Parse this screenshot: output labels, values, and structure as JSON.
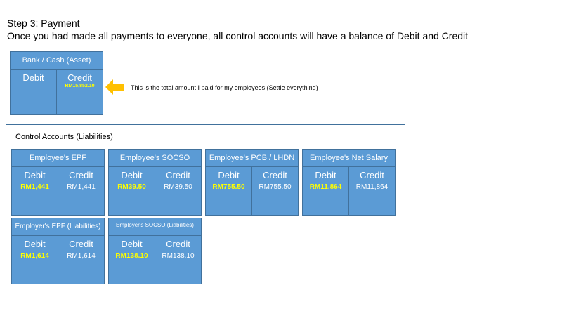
{
  "header": {
    "step": "Step 3: Payment",
    "description": "Once you had made all payments to everyone, all control accounts will have a balance of Debit and Credit"
  },
  "bank_account": {
    "title": "Bank / Cash (Asset)",
    "debit_label": "Debit",
    "credit_label": "Credit",
    "credit_value": "RM15,852.10"
  },
  "note": "This is the total amount I paid for my employees  (Settle everything)",
  "control_group": {
    "title": "Control Accounts (Liabilities)"
  },
  "accounts": {
    "employee_epf": {
      "title": "Employee's EPF",
      "debit_label": "Debit",
      "credit_label": "Credit",
      "debit": "RM1,441",
      "credit": "RM1,441"
    },
    "employee_socso": {
      "title": "Employee's SOCSO",
      "debit_label": "Debit",
      "credit_label": "Credit",
      "debit": "RM39.50",
      "credit": "RM39.50"
    },
    "employee_pcb": {
      "title": "Employee's PCB / LHDN",
      "debit_label": "Debit",
      "credit_label": "Credit",
      "debit": "RM755.50",
      "credit": "RM755.50"
    },
    "employee_net_salary": {
      "title": "Employee's Net Salary",
      "debit_label": "Debit",
      "credit_label": "Credit",
      "debit": "RM11,864",
      "credit": "RM11,864"
    },
    "employer_epf": {
      "title": "Employer's EPF (Liabilities)",
      "debit_label": "Debit",
      "credit_label": "Credit",
      "debit": "RM1,614",
      "credit": "RM1,614"
    },
    "employer_socso": {
      "title": "Employer's  SOCSO (Liabilities)",
      "debit_label": "Debit",
      "credit_label": "Credit",
      "debit": "RM138.10",
      "credit": "RM138.10"
    }
  },
  "colors": {
    "box_fill": "#5b9bd5",
    "box_border": "#41719c",
    "highlight_text": "#ffff00",
    "arrow": "#ffc000"
  }
}
